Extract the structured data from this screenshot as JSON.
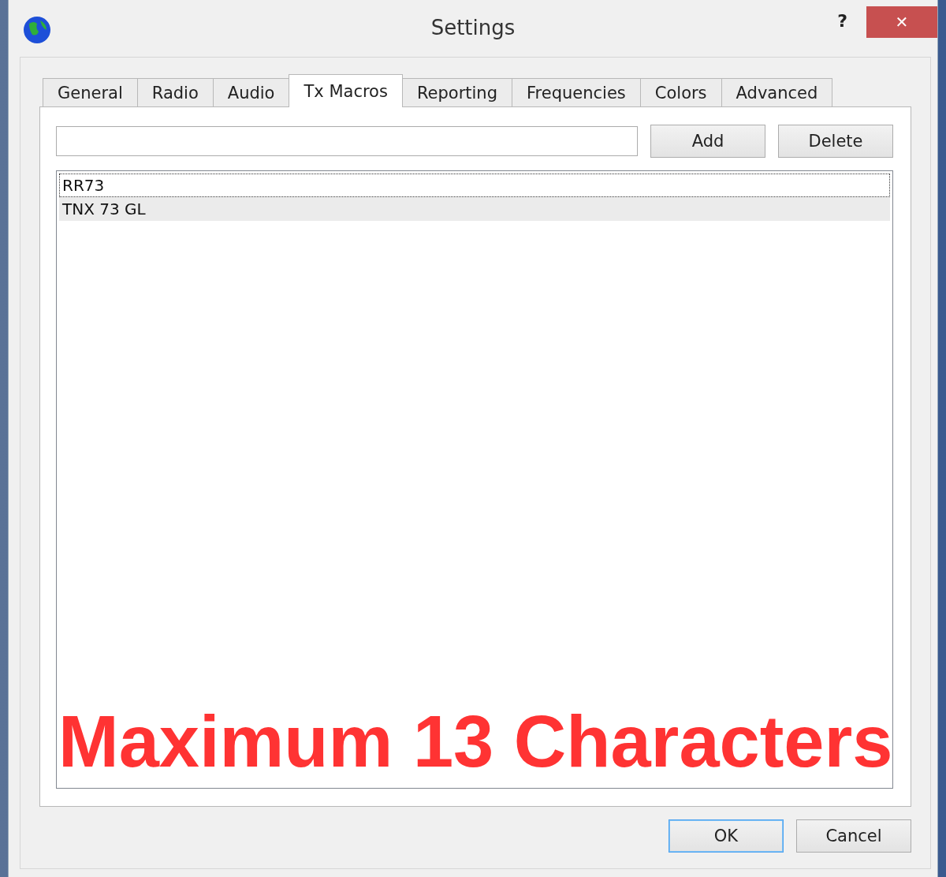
{
  "window": {
    "title": "Settings",
    "help": "?",
    "close": "✕"
  },
  "tabs": [
    {
      "label": "General",
      "selected": false
    },
    {
      "label": "Radio",
      "selected": false
    },
    {
      "label": "Audio",
      "selected": false
    },
    {
      "label": "Tx Macros",
      "selected": true
    },
    {
      "label": "Reporting",
      "selected": false
    },
    {
      "label": "Frequencies",
      "selected": false
    },
    {
      "label": "Colors",
      "selected": false
    },
    {
      "label": "Advanced",
      "selected": false
    }
  ],
  "buttons": [
    {
      "label": "Add"
    },
    {
      "label": "Delete"
    }
  ],
  "macros": [
    {
      "text": "RR73",
      "focused": true,
      "highlighted": false
    },
    {
      "text": "TNX 73 GL",
      "focused": false,
      "highlighted": true
    }
  ],
  "annotation": "Maximum 13 Characters",
  "dialog_buttons": [
    {
      "label": "OK",
      "default": true
    },
    {
      "label": "Cancel",
      "default": false
    }
  ]
}
